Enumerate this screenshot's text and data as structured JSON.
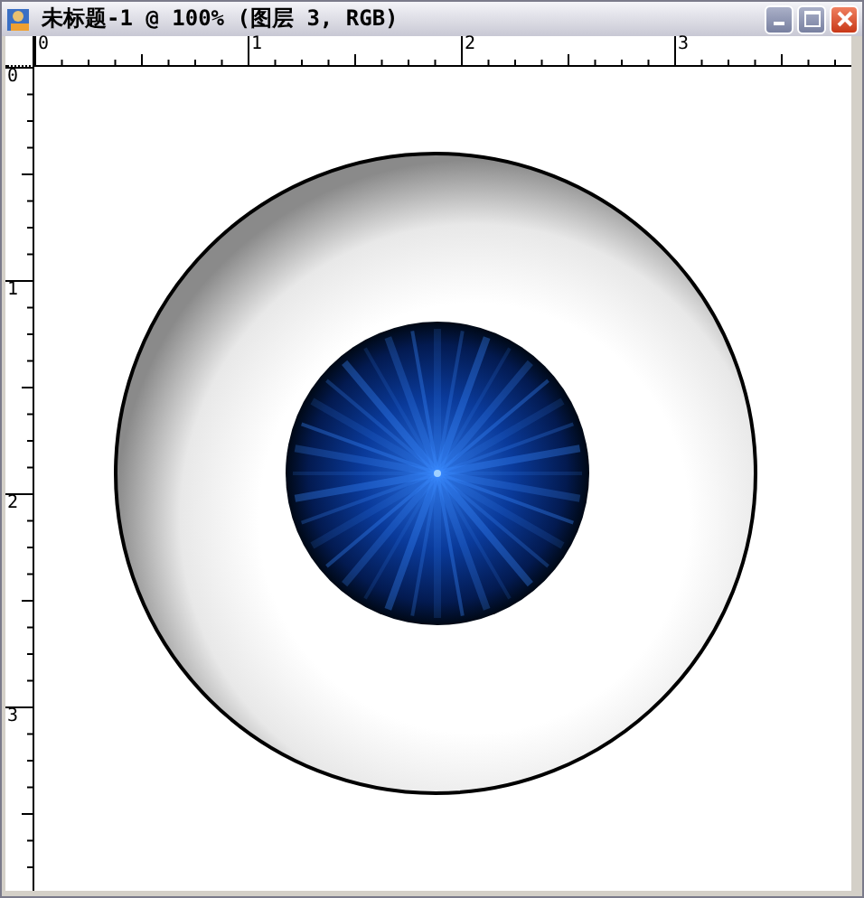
{
  "window": {
    "title": "未标题-1 @ 100% (图层 3, RGB)"
  },
  "rulers": {
    "horizontal": [
      "0",
      "1",
      "2",
      "3"
    ],
    "vertical": [
      "0",
      "1",
      "2",
      "3"
    ]
  }
}
